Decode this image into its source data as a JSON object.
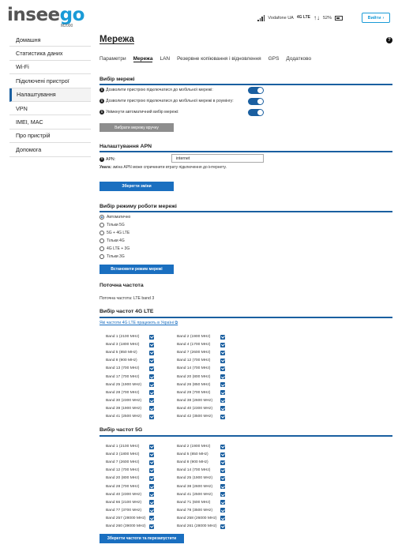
{
  "header": {
    "logo_prefix": "insee",
    "logo_accent": "go",
    "model": "M2000",
    "carrier": "Vodafone UA",
    "network_badge": "4G LTE",
    "battery": "52%",
    "logout_label": "Вийти"
  },
  "sidebar": {
    "items": [
      {
        "label": "Домашня"
      },
      {
        "label": "Статистика даних"
      },
      {
        "label": "Wi-Fi"
      },
      {
        "label": "Підключені пристрої"
      },
      {
        "label": "Налаштування",
        "active": true
      },
      {
        "label": "VPN"
      },
      {
        "label": "IMEI, MAC"
      },
      {
        "label": "Про пристрій"
      },
      {
        "label": "Допомога"
      }
    ]
  },
  "main": {
    "title": "Мережа",
    "help_icon": "?",
    "tabs": [
      "Параметри",
      "Мережа",
      "LAN",
      "Резервне копіювання і відновлення",
      "GPS",
      "Додатково"
    ],
    "active_tab": "Мережа",
    "network_select": {
      "title": "Вибір мережі",
      "toggles": [
        {
          "label": "Дозволити пристрою підключатися до мобільної мережі:",
          "on": true
        },
        {
          "label": "Дозволити пристрою підключатися до мобільної мережі в роумінгу:",
          "on": true
        },
        {
          "label": "Увімкнути автоматичний вибір мережі:",
          "on": true
        }
      ],
      "manual_button": "Вибрати мережу вручну"
    },
    "apn": {
      "title": "Налаштування APN",
      "label": "APN:",
      "value": "internet",
      "note_bold": "Увага:",
      "note_text": " зміна APN може спричинити втрату підключення до інтернету.",
      "save_button": "Зберегти зміни"
    },
    "mode": {
      "title": "Вибір режиму роботи мережі",
      "options": [
        "Автоматично",
        "Тільки 5G",
        "5G + 4G LTE",
        "Тільки 4G",
        "4G LTE + 3G",
        "Тільки 3G"
      ],
      "selected": "Автоматично",
      "set_button": "Встановити режим мережі"
    },
    "current_freq": {
      "title": "Поточна частота",
      "text": "Поточна частота: LTE band 3"
    },
    "lte_bands": {
      "title": "Вибір частот 4G LTE",
      "link": "Які частоти 4G LTE працюють в Україні",
      "left": [
        "Band 1 (2100 MHz)",
        "Band 3 (1800 MHz)",
        "Band 5 (850 MHz)",
        "Band 8 (900 MHz)",
        "Band 13 (700 MHz)",
        "Band 17 (700 MHz)",
        "Band 25 (1900 MHz)",
        "Band 28 (700 MHz)",
        "Band 30 (2300 MHz)",
        "Band 39 (1900 MHz)",
        "Band 41 (2500 MHz)"
      ],
      "right": [
        "Band 2 (1900 MHz)",
        "Band 4 (1700 MHz)",
        "Band 7 (2600 MHz)",
        "Band 12 (700 MHz)",
        "Band 14 (700 MHz)",
        "Band 20 (800 MHz)",
        "Band 26 (850 MHz)",
        "Band 29 (700 MHz)",
        "Band 38 (2600 MHz)",
        "Band 40 (2300 MHz)",
        "Band 42 (3500 MHz)"
      ]
    },
    "nr_bands": {
      "title": "Вибір частот 5G",
      "left": [
        "Band 1 (2100 MHz)",
        "Band 3 (1800 MHz)",
        "Band 7 (2600 MHz)",
        "Band 12 (700 MHz)",
        "Band 20 (800 MHz)",
        "Band 28 (700 MHz)",
        "Band 40 (2300 MHz)",
        "Band 66 (2100 MHz)",
        "Band 77 (3700 MHz)",
        "Band 257 (28000 MHz)",
        "Band 260 (39000 MHz)"
      ],
      "right": [
        "Band 2 (1900 MHz)",
        "Band 5 (850 MHz)",
        "Band 8 (900 MHz)",
        "Band 14 (700 MHz)",
        "Band 25 (1900 MHz)",
        "Band 38 (2600 MHz)",
        "Band 41 (2500 MHz)",
        "Band 71 (600 MHz)",
        "Band 78 (3500 MHz)",
        "Band 258 (26000 MHz)",
        "Band 261 (28000 MHz)"
      ],
      "save_button": "Зберегти частоти та перезапустити"
    }
  },
  "colors": {
    "accent": "#1a5fa0",
    "button_blue": "#1a6fc0",
    "logo_blue": "#1a9bd7",
    "button_gray": "#8e8e8e"
  }
}
